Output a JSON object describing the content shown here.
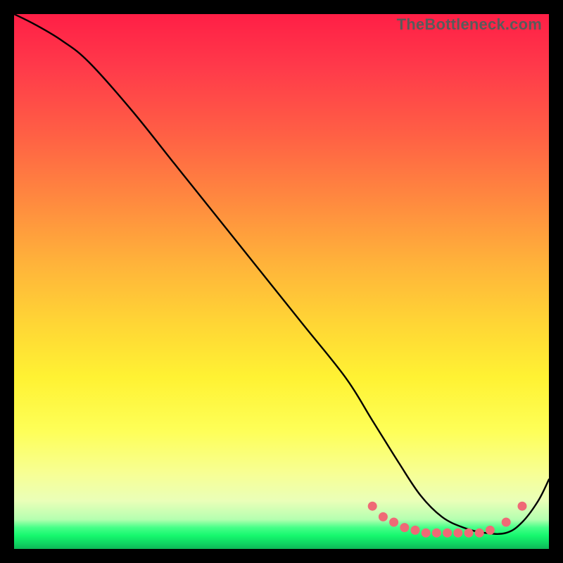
{
  "watermark": "TheBottleneck.com",
  "chart_data": {
    "type": "line",
    "title": "",
    "xlabel": "",
    "ylabel": "",
    "xlim": [
      0,
      100
    ],
    "ylim": [
      0,
      100
    ],
    "series": [
      {
        "name": "curve",
        "x": [
          0,
          4,
          9,
          14,
          22,
          30,
          38,
          46,
          54,
          62,
          67,
          72,
          76,
          80,
          84,
          88,
          92,
          95,
          98,
          100
        ],
        "y": [
          100,
          98,
          95,
          91,
          82,
          72,
          62,
          52,
          42,
          32,
          24,
          16,
          10,
          6,
          4,
          3,
          3,
          5,
          9,
          13
        ]
      }
    ],
    "markers": {
      "name": "highlight-dots",
      "color": "#ef6a76",
      "points": [
        {
          "x": 67,
          "y": 8
        },
        {
          "x": 69,
          "y": 6
        },
        {
          "x": 71,
          "y": 5
        },
        {
          "x": 73,
          "y": 4
        },
        {
          "x": 75,
          "y": 3.5
        },
        {
          "x": 77,
          "y": 3
        },
        {
          "x": 79,
          "y": 3
        },
        {
          "x": 81,
          "y": 3
        },
        {
          "x": 83,
          "y": 3
        },
        {
          "x": 85,
          "y": 3
        },
        {
          "x": 87,
          "y": 3
        },
        {
          "x": 89,
          "y": 3.5
        },
        {
          "x": 92,
          "y": 5
        },
        {
          "x": 95,
          "y": 8
        }
      ]
    }
  }
}
